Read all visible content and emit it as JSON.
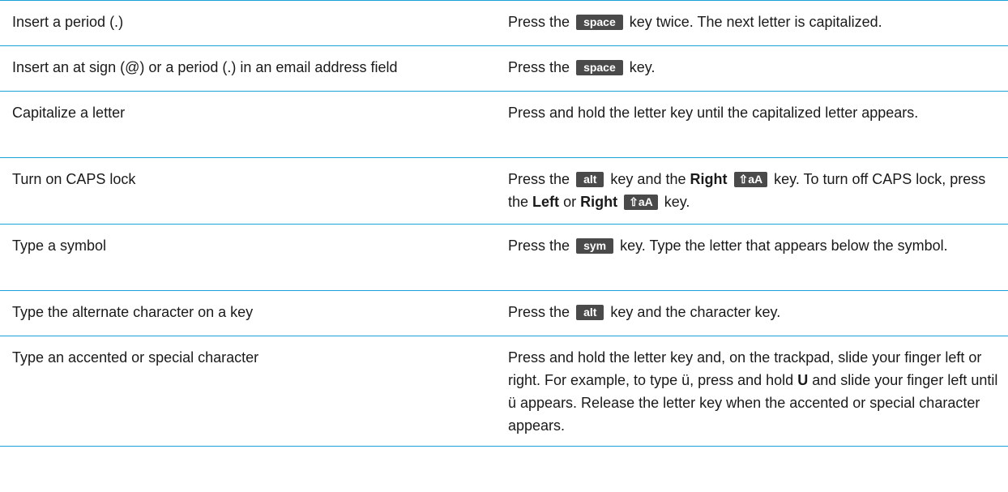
{
  "rows": [
    {
      "action": "Insert a period (.)",
      "d": [
        "Press the",
        "space",
        "key twice. The next letter is capitalized."
      ]
    },
    {
      "action": "Insert an at sign (@) or a period (.) in an email address field",
      "d": [
        "Press the",
        "space",
        "key."
      ]
    },
    {
      "action": "Capitalize a letter",
      "d": [
        "Press and hold the letter key until the capitalized letter appears."
      ]
    },
    {
      "action": "Turn on CAPS lock",
      "d": [
        "Press the",
        "alt",
        "key and the",
        "Right",
        "⇧aA",
        "key. To turn off CAPS lock, press the",
        "Left",
        "or",
        "Right",
        "⇧aA",
        "key."
      ]
    },
    {
      "action": "Type a symbol",
      "d": [
        "Press the",
        "sym",
        "key. Type the letter that appears below the symbol."
      ]
    },
    {
      "action": "Type the alternate character on a key",
      "d": [
        "Press the",
        "alt",
        "key and the character key."
      ]
    },
    {
      "action": "Type an accented or special character",
      "d": [
        "Press and hold the letter key and, on the trackpad, slide your finger left or right. For example, to type ü, press and hold",
        "U",
        "and slide your finger left until ü appears. Release the letter key when the accented or special character appears."
      ]
    }
  ],
  "colors": {
    "rule": "#1aa3d9",
    "key_bg": "#4a4a4a",
    "text": "#1a1a1a"
  },
  "icons": {
    "shift_key": "shift-arrow-icon"
  }
}
